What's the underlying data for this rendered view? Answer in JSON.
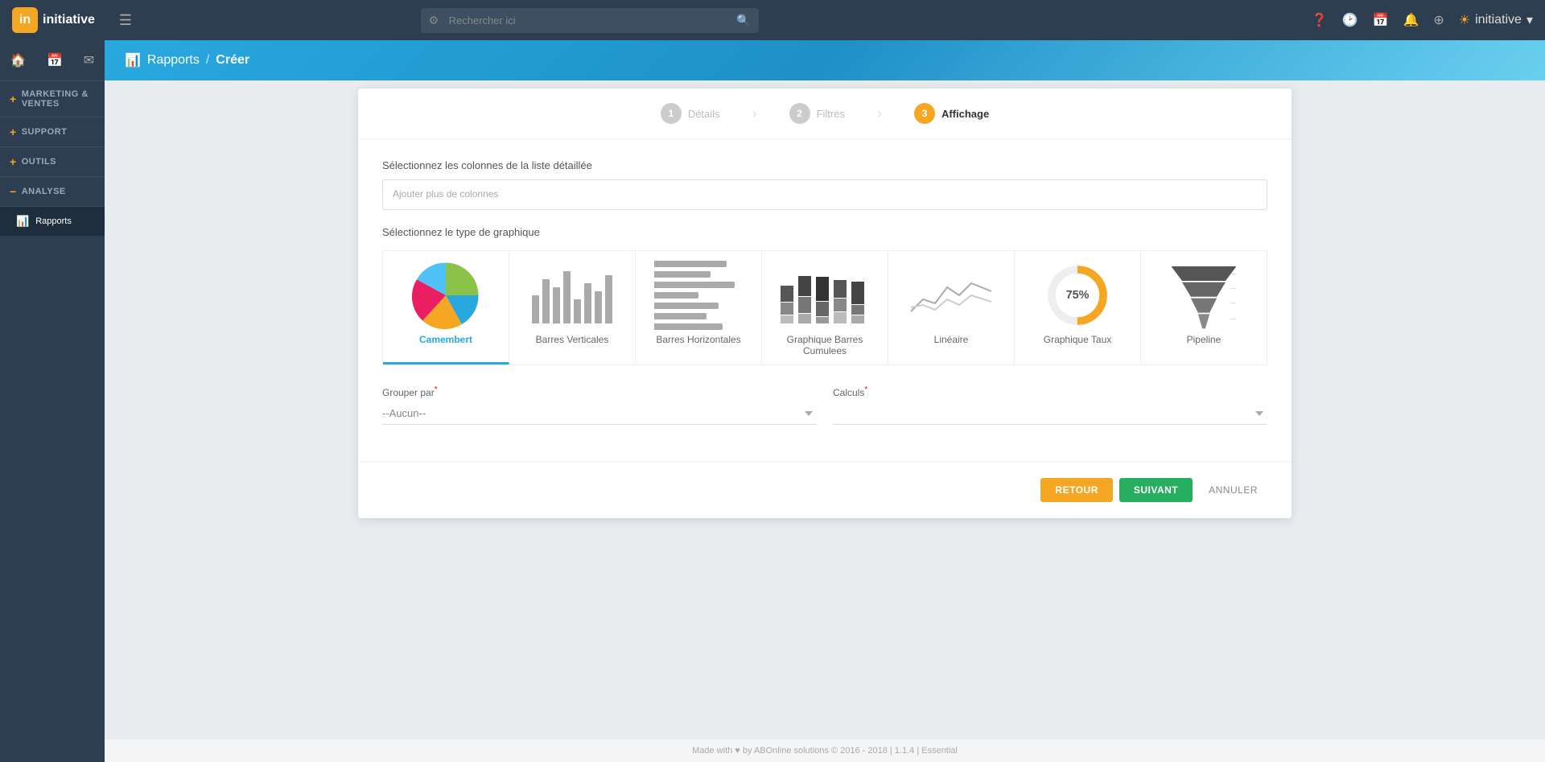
{
  "app": {
    "logo_letter": "in",
    "title": "initiative"
  },
  "topbar": {
    "menu_icon": "☰",
    "search_placeholder": "Rechercher ici",
    "user_name": "initiative",
    "sun_icon": "☀",
    "icons": [
      "?",
      "🕐",
      "📅",
      "🔔",
      "⊕"
    ]
  },
  "sidebar": {
    "top_icons": [
      "🏠",
      "📅",
      "✉"
    ],
    "items": [
      {
        "label": "MARKETING & VENTES",
        "icon": "+"
      },
      {
        "label": "SUPPORT",
        "icon": "+"
      },
      {
        "label": "OUTILS",
        "icon": "+"
      },
      {
        "label": "ANALYSE",
        "icon": "−"
      },
      {
        "label": "Rapports",
        "icon": "📊",
        "active": true
      }
    ]
  },
  "breadcrumb": {
    "section": "Rapports",
    "separator": "/",
    "page": "Créer",
    "icon": "📊"
  },
  "steps": [
    {
      "number": "1",
      "label": "Détails",
      "state": "done"
    },
    {
      "number": "2",
      "label": "Filtres",
      "state": "done"
    },
    {
      "number": "3",
      "label": "Affichage",
      "state": "active"
    }
  ],
  "form": {
    "columns_label": "Sélectionnez les colonnes de la liste détaillée",
    "columns_placeholder": "Ajouter plus de colonnes",
    "chart_label": "Sélectionnez le type de graphique",
    "chart_types": [
      {
        "id": "camembert",
        "label": "Camembert",
        "selected": true
      },
      {
        "id": "barres-verticales",
        "label": "Barres Verticales",
        "selected": false
      },
      {
        "id": "barres-horizontales",
        "label": "Barres Horizontales",
        "selected": false
      },
      {
        "id": "graphique-barres-cumulees",
        "label": "Graphique Barres Cumulees",
        "selected": false
      },
      {
        "id": "lineaire",
        "label": "Linéaire",
        "selected": false
      },
      {
        "id": "graphique-taux",
        "label": "Graphique Taux",
        "selected": false
      },
      {
        "id": "pipeline",
        "label": "Pipeline",
        "selected": false
      }
    ],
    "grouper_label": "Grouper par",
    "grouper_required": "*",
    "grouper_value": "--Aucun--",
    "calculs_label": "Calculs",
    "calculs_required": "*",
    "calculs_value": ""
  },
  "buttons": {
    "retour": "RETOUR",
    "suivant": "SUIVANT",
    "annuler": "ANNULER"
  },
  "footer": {
    "text": "Made with ♥ by ABOnline solutions © 2016 - 2018 | 1.1.4 | Essential"
  }
}
